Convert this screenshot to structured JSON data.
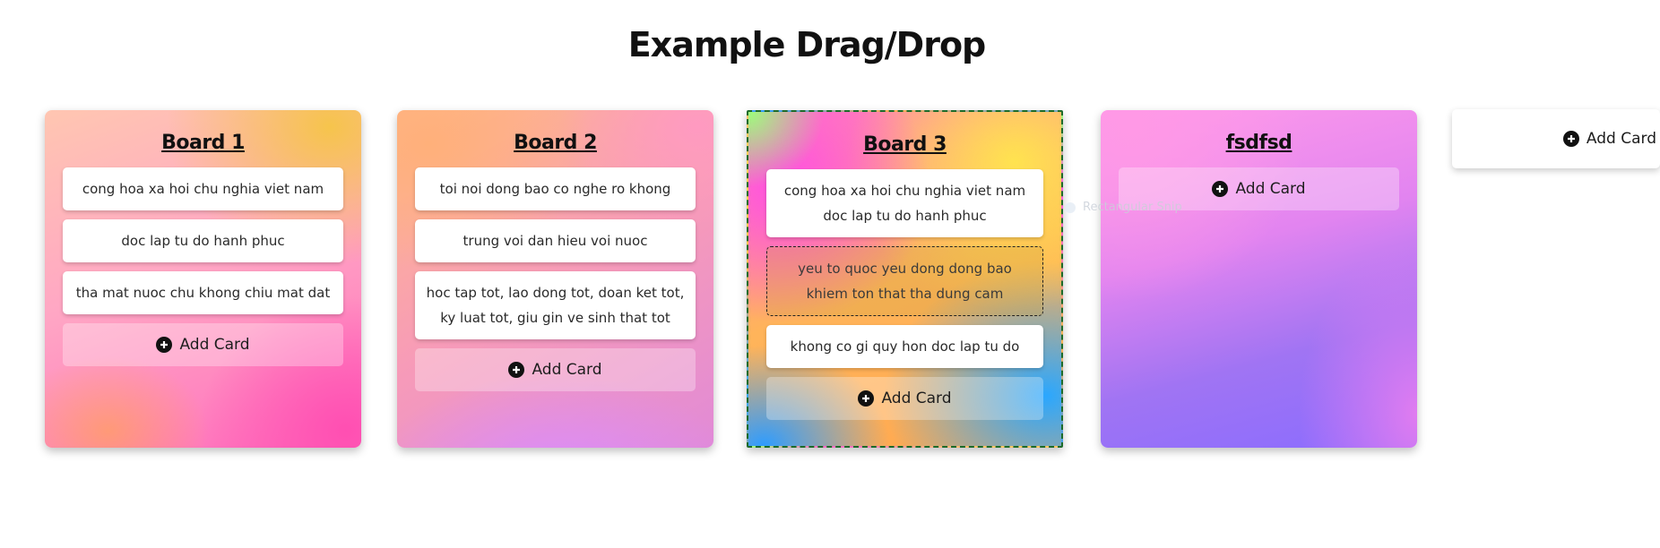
{
  "page": {
    "title": "Example Drag/Drop"
  },
  "boards": [
    {
      "title": "Board 1",
      "cards": [
        "cong hoa xa hoi chu nghia viet nam",
        "doc lap tu do hanh phuc",
        "tha mat nuoc chu khong chiu mat dat"
      ],
      "add_label": "Add Card"
    },
    {
      "title": "Board 2",
      "cards": [
        "toi noi dong bao co nghe ro khong",
        "trung voi dan hieu voi nuoc",
        "hoc tap tot, lao dong tot, doan ket tot, ky luat tot, giu gin ve sinh that tot"
      ],
      "add_label": "Add Card"
    },
    {
      "title": "Board 3",
      "cards": [
        "cong hoa xa hoi chu nghia viet nam doc lap tu do hanh phuc",
        "yeu to quoc yeu dong dong bao khiem ton that tha dung cam",
        "khong co gi quy hon doc lap tu do"
      ],
      "add_label": "Add Card"
    },
    {
      "title": "fsdfsd",
      "cards": [],
      "add_label": "Add Card"
    }
  ],
  "add_board": {
    "label": "Add Card"
  },
  "drag_ghost": {
    "label": "Rectangular Snip"
  }
}
